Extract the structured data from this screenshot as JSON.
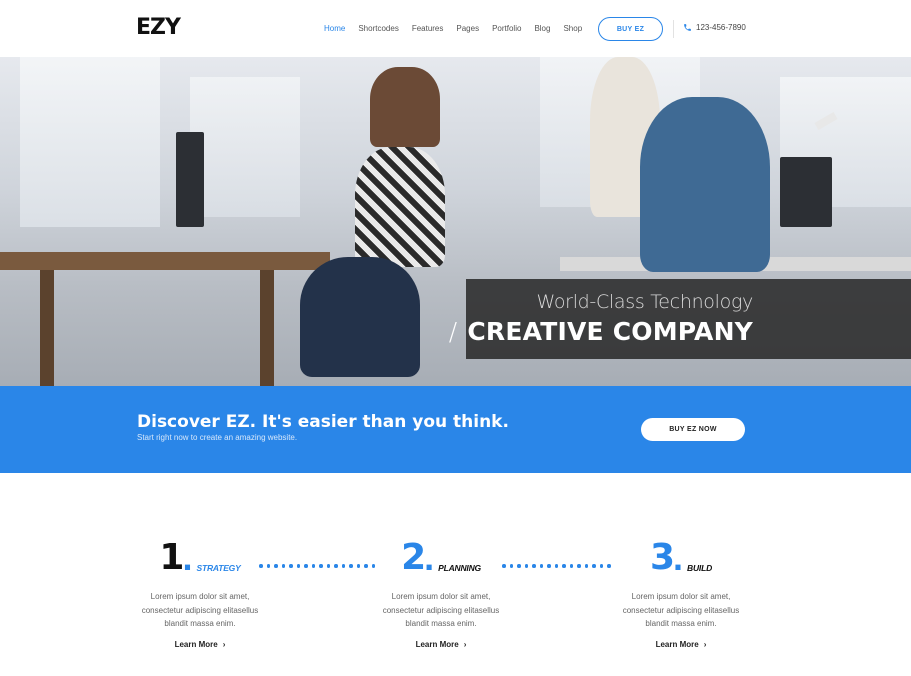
{
  "header": {
    "logo": "EZY",
    "nav": [
      "Home",
      "Shortcodes",
      "Features",
      "Pages",
      "Portfolio",
      "Blog",
      "Shop"
    ],
    "active_nav": "Home",
    "buy_button": "BUY EZ",
    "phone": "123-456-7890"
  },
  "hero": {
    "line1": "World-Class Technology",
    "line2_slash": "/",
    "line2": "CREATIVE COMPANY"
  },
  "cta": {
    "title": "Discover EZ. It's easier than you think.",
    "subtitle": "Start right now to create an amazing website.",
    "button": "BUY EZ NOW"
  },
  "steps": [
    {
      "number": "1",
      "dot": ".",
      "label": "STRATEGY",
      "line1": "Lorem ipsum dolor sit amet,",
      "line2": "consectetur adipiscing elitasellus",
      "line3": "blandit massa enim.",
      "link": "Learn More"
    },
    {
      "number": "2",
      "dot": ".",
      "label": "PLANNING",
      "line1": "Lorem ipsum dolor sit amet,",
      "line2": "consectetur adipiscing elitasellus",
      "line3": "blandit massa enim.",
      "link": "Learn More"
    },
    {
      "number": "3",
      "dot": ".",
      "label": "BUILD",
      "line1": "Lorem ipsum dolor sit amet,",
      "line2": "consectetur adipiscing elitasellus",
      "line3": "blandit massa enim.",
      "link": "Learn More"
    }
  ],
  "colors": {
    "accent": "#2a86e8",
    "dark": "#111111",
    "caption_bg": "#282828"
  },
  "icons": [
    "phone-icon",
    "chevron-right-icon"
  ]
}
